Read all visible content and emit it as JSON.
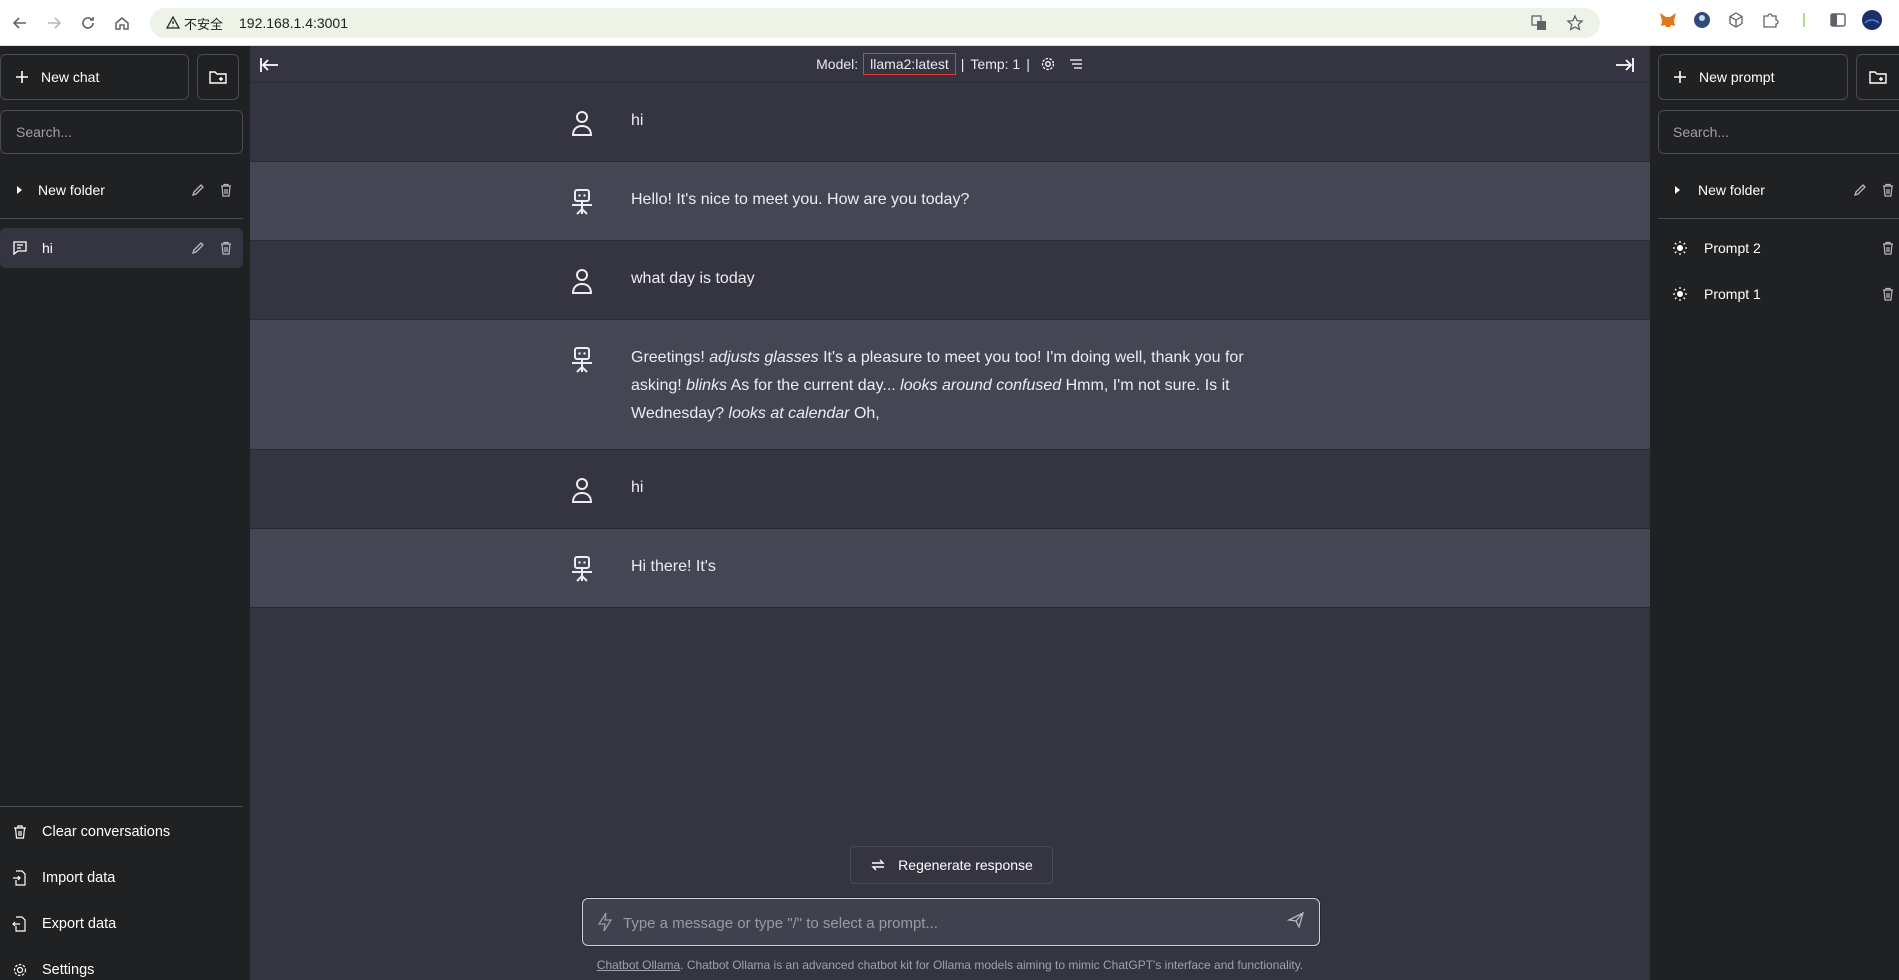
{
  "browser": {
    "security_label": "不安全",
    "url": "192.168.1.4:3001"
  },
  "left_sidebar": {
    "new_chat_label": "New chat",
    "search_placeholder": "Search...",
    "folder_label": "New folder",
    "chat_item_label": "hi",
    "bottom_items": [
      "Clear conversations",
      "Import data",
      "Export data",
      "Settings"
    ]
  },
  "topbar": {
    "model_label": "Model:",
    "model_value": "llama2:latest",
    "sep": "|",
    "temp_label": "Temp: 1"
  },
  "messages": [
    {
      "role": "user",
      "text": "hi"
    },
    {
      "role": "bot",
      "text": "Hello! It's nice to meet you. How are you today?"
    },
    {
      "role": "user",
      "text": "what day is today"
    },
    {
      "role": "bot",
      "parts": [
        "Greetings! ",
        "adjusts glasses",
        " It's a pleasure to meet you too! I'm doing well, thank you for asking! ",
        "blinks",
        " As for the current day... ",
        "looks around confused",
        " Hmm, I'm not sure. Is it Wednesday? ",
        "looks at calendar",
        " Oh,"
      ]
    },
    {
      "role": "user",
      "text": "hi"
    },
    {
      "role": "bot",
      "text": "Hi there! It's"
    }
  ],
  "composer": {
    "regenerate_label": "Regenerate response",
    "placeholder": "Type a message or type \"/\" to select a prompt..."
  },
  "footer": {
    "link_text": "Chatbot Ollama",
    "text": ". Chatbot Ollama is an advanced chatbot kit for Ollama models aiming to mimic ChatGPT's interface and functionality."
  },
  "right_sidebar": {
    "new_prompt_label": "New prompt",
    "search_placeholder": "Search...",
    "folder_label": "New folder",
    "prompts": [
      "Prompt 2",
      "Prompt 1"
    ]
  },
  "colors": {
    "sidebar_bg": "#202123",
    "main_bg": "#343541",
    "bot_row_bg": "#444654",
    "annotation_red": "#e53935"
  }
}
